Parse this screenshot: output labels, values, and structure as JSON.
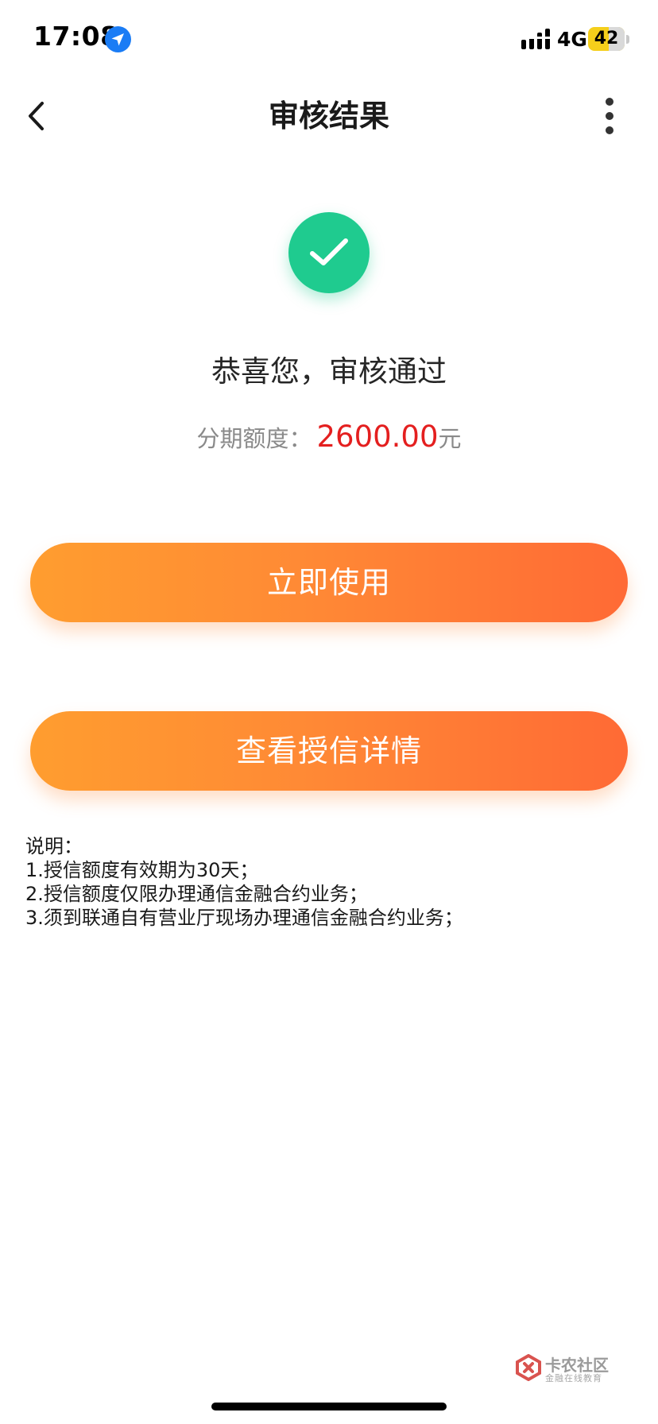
{
  "status_bar": {
    "time": "17:08",
    "network": "4G",
    "battery": "42",
    "icons": [
      "location-arrow-icon",
      "signal-icon"
    ]
  },
  "nav": {
    "title": "审核结果",
    "back_icon": "chevron-left-icon",
    "more_icon": "more-vertical-icon"
  },
  "result": {
    "icon": "check-circle-icon",
    "title": "恭喜您，审核通过",
    "credit_label": "分期额度：",
    "credit_amount": "2600.00",
    "credit_unit": "元"
  },
  "buttons": {
    "use_now": "立即使用",
    "view_details": "查看授信详情"
  },
  "notes": {
    "title": "说明：",
    "items": [
      "1.授信额度有效期为30天；",
      "2.授信额度仅限办理通信金融合约业务；",
      "3.须到联通自有营业厅现场办理通信金融合约业务；"
    ]
  },
  "watermark": {
    "title": "卡农社区",
    "subtitle": "金融在线教育"
  },
  "colors": {
    "success": "#1fcb8f",
    "amount": "#e41f1f",
    "button_start": "#ff9d2f",
    "button_end": "#ff6a35",
    "battery": "#f5cf1b"
  }
}
